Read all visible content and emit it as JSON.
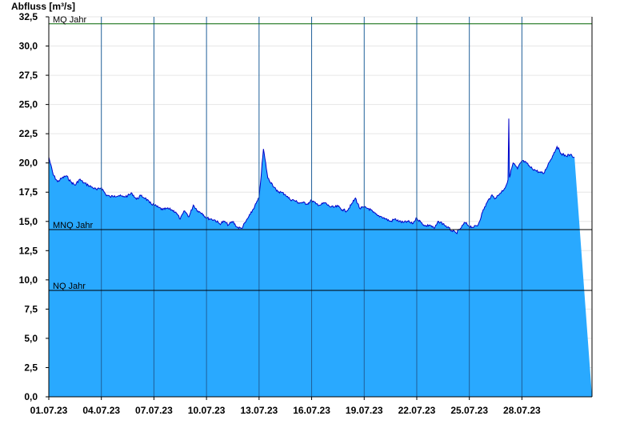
{
  "chart_data": {
    "type": "area",
    "ylabel": "Abfluss [m³/s]",
    "xlabel": "",
    "title": "",
    "ylim": [
      0,
      32.5
    ],
    "xlim": [
      "01.07.23",
      "31.07.23"
    ],
    "y_ticks": [
      "0,0",
      "2,5",
      "5,0",
      "7,5",
      "10,0",
      "12,5",
      "15,0",
      "17,5",
      "20,0",
      "22,5",
      "25,0",
      "27,5",
      "30,0",
      "32,5"
    ],
    "x_ticks": [
      "01.07.23",
      "04.07.23",
      "07.07.23",
      "10.07.23",
      "13.07.23",
      "16.07.23",
      "19.07.23",
      "22.07.23",
      "25.07.23",
      "28.07.23"
    ],
    "grid": true,
    "colors": {
      "fill": "#29a9ff",
      "line": "#0000c8",
      "mq_line": "#006400",
      "ref_line": "#000000",
      "vgrid": "#1f5f99"
    },
    "reference_lines": [
      {
        "name": "MQ Jahr",
        "value": 31.9
      },
      {
        "name": "MNQ Jahr",
        "value": 14.3
      },
      {
        "name": "NQ Jahr",
        "value": 9.1
      }
    ],
    "series": [
      {
        "x": [
          "01.07.23 00:00",
          "01.07.23 06:00",
          "01.07.23 12:00",
          "01.07.23 18:00",
          "02.07.23 00:00",
          "02.07.23 06:00",
          "02.07.23 12:00",
          "02.07.23 18:00",
          "03.07.23 00:00",
          "03.07.23 06:00",
          "03.07.23 12:00",
          "03.07.23 18:00",
          "04.07.23 00:00",
          "04.07.23 06:00",
          "04.07.23 12:00",
          "04.07.23 18:00",
          "05.07.23 00:00",
          "05.07.23 06:00",
          "05.07.23 12:00",
          "05.07.23 18:00",
          "06.07.23 00:00",
          "06.07.23 06:00",
          "06.07.23 12:00",
          "06.07.23 18:00",
          "07.07.23 00:00",
          "07.07.23 06:00",
          "07.07.23 12:00",
          "07.07.23 18:00",
          "08.07.23 00:00",
          "08.07.23 06:00",
          "08.07.23 12:00",
          "08.07.23 18:00",
          "09.07.23 00:00",
          "09.07.23 06:00",
          "09.07.23 12:00",
          "09.07.23 18:00",
          "10.07.23 00:00",
          "10.07.23 06:00",
          "10.07.23 12:00",
          "10.07.23 18:00",
          "11.07.23 00:00",
          "11.07.23 06:00",
          "11.07.23 12:00",
          "11.07.23 18:00",
          "12.07.23 00:00",
          "12.07.23 06:00",
          "12.07.23 12:00",
          "12.07.23 18:00",
          "13.07.23 00:00",
          "13.07.23 06:00",
          "13.07.23 12:00",
          "13.07.23 18:00",
          "14.07.23 00:00",
          "14.07.23 06:00",
          "14.07.23 12:00",
          "14.07.23 18:00",
          "15.07.23 00:00",
          "15.07.23 06:00",
          "15.07.23 12:00",
          "15.07.23 18:00",
          "16.07.23 00:00",
          "16.07.23 06:00",
          "16.07.23 12:00",
          "16.07.23 18:00",
          "17.07.23 00:00",
          "17.07.23 06:00",
          "17.07.23 12:00",
          "17.07.23 18:00",
          "18.07.23 00:00",
          "18.07.23 06:00",
          "18.07.23 12:00",
          "18.07.23 18:00",
          "19.07.23 00:00",
          "19.07.23 06:00",
          "19.07.23 12:00",
          "19.07.23 18:00",
          "20.07.23 00:00",
          "20.07.23 06:00",
          "20.07.23 12:00",
          "20.07.23 18:00",
          "21.07.23 00:00",
          "21.07.23 06:00",
          "21.07.23 12:00",
          "21.07.23 18:00",
          "22.07.23 00:00",
          "22.07.23 06:00",
          "22.07.23 12:00",
          "22.07.23 18:00",
          "23.07.23 00:00",
          "23.07.23 06:00",
          "23.07.23 12:00",
          "23.07.23 18:00",
          "24.07.23 00:00",
          "24.07.23 06:00",
          "24.07.23 12:00",
          "24.07.23 18:00",
          "25.07.23 00:00",
          "25.07.23 06:00",
          "25.07.23 12:00",
          "25.07.23 18:00",
          "26.07.23 00:00",
          "26.07.23 06:00",
          "26.07.23 12:00",
          "26.07.23 18:00",
          "27.07.23 00:00",
          "27.07.23 06:00",
          "27.07.23 12:00",
          "27.07.23 18:00",
          "28.07.23 00:00",
          "28.07.23 06:00",
          "28.07.23 12:00",
          "28.07.23 18:00",
          "29.07.23 00:00",
          "29.07.23 06:00",
          "29.07.23 12:00",
          "29.07.23 18:00",
          "30.07.23 00:00",
          "30.07.23 06:00",
          "30.07.23 12:00",
          "30.07.23 18:00",
          "31.07.23 00:00"
        ],
        "values": [
          20.5,
          19.0,
          18.4,
          18.7,
          18.9,
          18.4,
          18.1,
          18.6,
          18.3,
          18.1,
          17.9,
          17.7,
          17.9,
          17.3,
          17.1,
          17.2,
          17.2,
          17.1,
          17.2,
          17.4,
          16.9,
          17.2,
          17.0,
          16.6,
          16.4,
          16.2,
          16.0,
          16.1,
          16.0,
          15.8,
          15.2,
          15.9,
          15.4,
          16.4,
          15.9,
          15.7,
          15.3,
          15.2,
          15.1,
          14.8,
          15.0,
          14.7,
          15.0,
          14.5,
          14.4,
          15.0,
          15.6,
          16.3,
          17.0,
          21.2,
          18.7,
          18.2,
          17.6,
          17.5,
          17.3,
          16.9,
          16.8,
          16.6,
          16.6,
          16.5,
          16.8,
          16.5,
          16.4,
          16.6,
          16.3,
          16.2,
          16.3,
          16.0,
          15.9,
          16.4,
          17.0,
          16.1,
          16.2,
          16.1,
          15.8,
          15.5,
          15.4,
          15.2,
          15.0,
          15.2,
          15.0,
          14.9,
          15.0,
          14.8,
          15.3,
          14.9,
          14.6,
          14.7,
          14.4,
          15.0,
          14.8,
          14.5,
          14.2,
          14.0,
          14.4,
          14.9,
          14.6,
          14.5,
          14.7,
          15.8,
          16.6,
          17.2,
          17.0,
          17.4,
          17.8,
          18.6,
          20.0,
          19.5,
          20.2,
          20.0,
          19.6,
          19.4,
          19.2,
          19.1,
          19.9,
          20.6,
          21.4,
          20.8,
          20.6,
          20.7,
          20.5
        ],
        "annotations": {
          "peak_27_07": 23.8
        }
      }
    ]
  }
}
